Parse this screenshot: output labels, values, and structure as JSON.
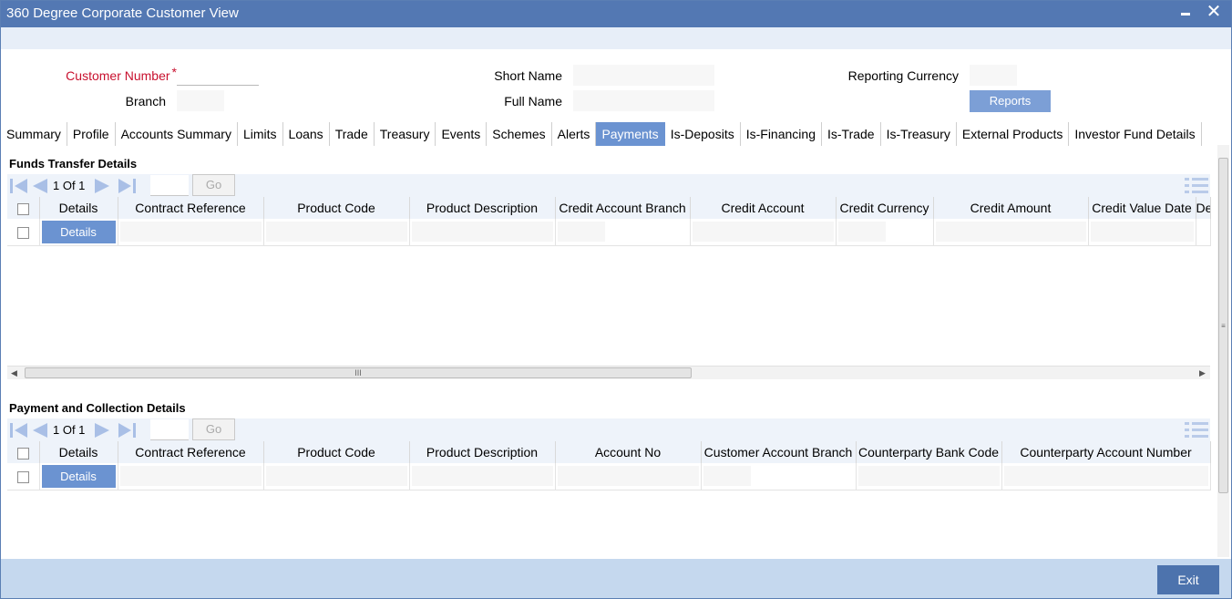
{
  "window": {
    "title": "360 Degree Corporate Customer View",
    "minimize_label": "",
    "close_label": "✕"
  },
  "header": {
    "customer_number_label": "Customer Number",
    "required_mark": "*",
    "branch_label": "Branch",
    "short_name_label": "Short Name",
    "full_name_label": "Full Name",
    "reporting_currency_label": "Reporting Currency",
    "reports_button": "Reports",
    "customer_number_value": "",
    "branch_value": "",
    "short_name_value": "",
    "full_name_value": "",
    "reporting_currency_value": ""
  },
  "tabs": [
    {
      "label": "Summary"
    },
    {
      "label": "Profile"
    },
    {
      "label": "Accounts Summary"
    },
    {
      "label": "Limits"
    },
    {
      "label": "Loans"
    },
    {
      "label": "Trade"
    },
    {
      "label": "Treasury"
    },
    {
      "label": "Events"
    },
    {
      "label": "Schemes"
    },
    {
      "label": "Alerts"
    },
    {
      "label": "Payments",
      "active": true
    },
    {
      "label": "Is-Deposits"
    },
    {
      "label": "Is-Financing"
    },
    {
      "label": "Is-Trade"
    },
    {
      "label": "Is-Treasury"
    },
    {
      "label": "External Products"
    },
    {
      "label": "Investor Fund Details"
    }
  ],
  "funds_transfer": {
    "title": "Funds Transfer Details",
    "pager": {
      "text": "1 Of 1",
      "go_label": "Go",
      "page_input": ""
    },
    "columns": [
      "Details",
      "Contract Reference",
      "Product Code",
      "Product Description",
      "Credit Account Branch",
      "Credit Account",
      "Credit Currency",
      "Credit Amount",
      "Credit Value Date",
      "De"
    ],
    "row_button": "Details"
  },
  "payment_collection": {
    "title": "Payment and Collection Details",
    "pager": {
      "text": "1 Of 1",
      "go_label": "Go",
      "page_input": ""
    },
    "columns": [
      "Details",
      "Contract Reference",
      "Product Code",
      "Product Description",
      "Account No",
      "Customer Account Branch",
      "Counterparty Bank Code",
      "Counterparty Account Number"
    ],
    "row_button": "Details"
  },
  "scroll": {
    "thumb_grip": "III"
  },
  "footer": {
    "exit_label": "Exit"
  },
  "colors": {
    "titlebar": "#5378b3",
    "tab_active": "#6b93d1",
    "button": "#6b93d1",
    "footer": "#c5d8ee",
    "required": "#c8102e"
  }
}
